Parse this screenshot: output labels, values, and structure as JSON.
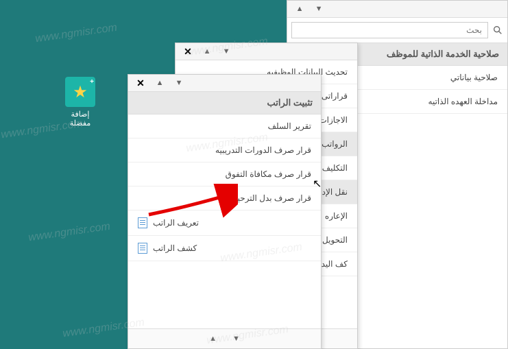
{
  "search": {
    "placeholder": "بحث"
  },
  "main": {
    "title": "صلاحية الخدمة الذاتية للموظف",
    "items": [
      "صلاحية بياناتي",
      "مداخلة العهده الذاتيه"
    ]
  },
  "sub": {
    "items": [
      {
        "label": "تحديث البيانات الوظيفيه",
        "active": false
      },
      {
        "label": "قراراتى",
        "active": false
      },
      {
        "label": "الاجازات",
        "active": false
      },
      {
        "label": "الرواتب والبدلات",
        "active": true
      },
      {
        "label": "التكليف",
        "active": false
      },
      {
        "label": "نقل الإداريين",
        "active": true
      },
      {
        "label": "الإعاره",
        "active": false
      },
      {
        "label": "التحويل للعمل الاداري",
        "active": false
      },
      {
        "label": "كف اليد",
        "active": false
      }
    ]
  },
  "third": {
    "title": "تثبيت الراتب",
    "items": [
      {
        "label": "تقرير السلف",
        "icon": false
      },
      {
        "label": "قرار صرف الدورات التدريبيه",
        "icon": false
      },
      {
        "label": "قرار صرف مكافاة التفوق",
        "icon": false
      },
      {
        "label": "قرار صرف بدل الترحيل",
        "icon": false
      },
      {
        "label": "تعريف الراتب",
        "icon": true
      },
      {
        "label": "كشف الراتب",
        "icon": true
      }
    ]
  },
  "fav": {
    "label": "إضافة مفضلة"
  },
  "watermark": "www.ngmisr.com"
}
